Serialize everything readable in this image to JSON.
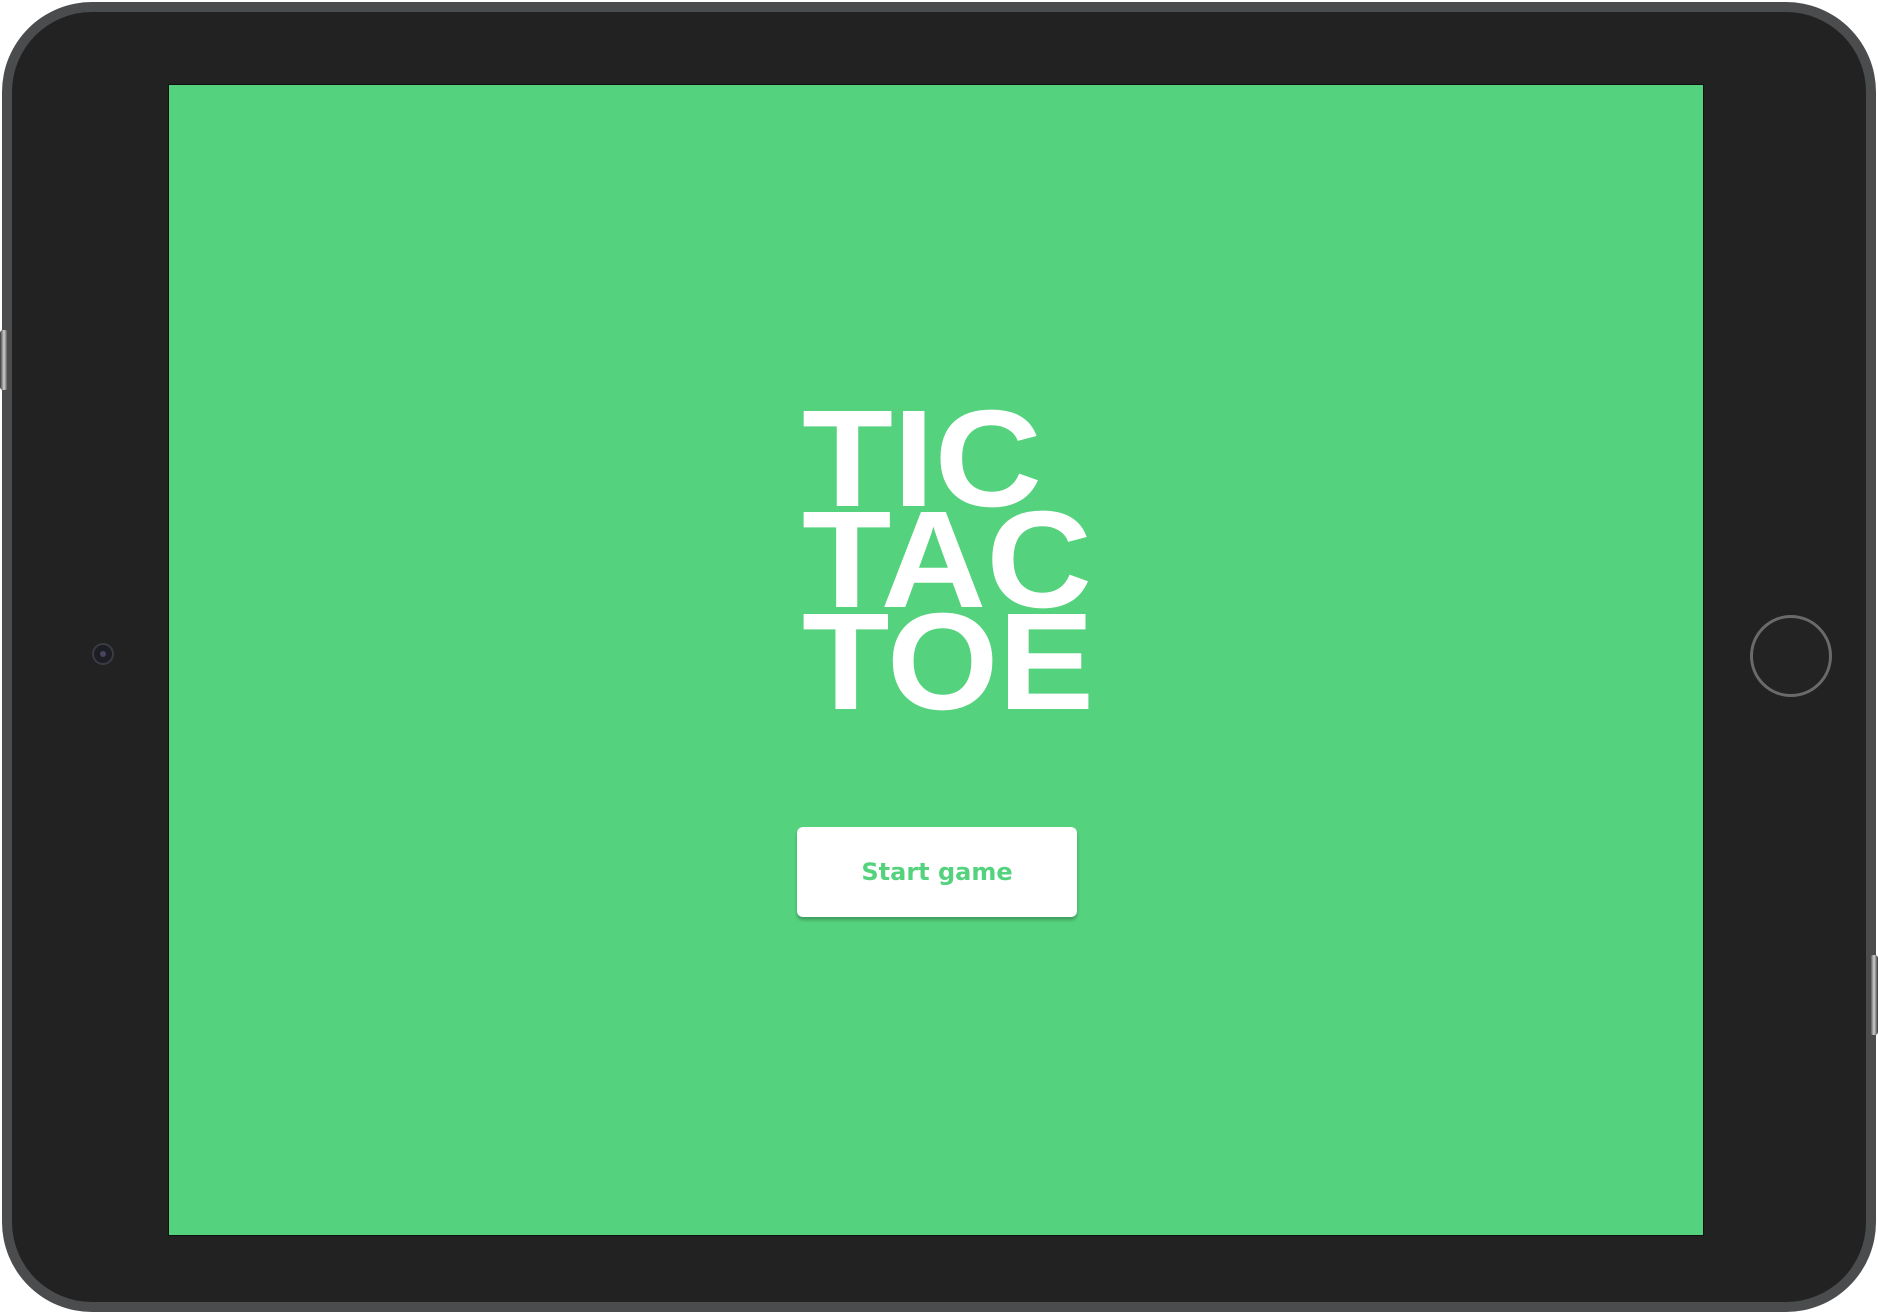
{
  "device": {
    "frame_color": "#222222",
    "bezel_color": "#4a4c4e",
    "camera_icon": "front-camera",
    "home_button_icon": "home-button-ring"
  },
  "screen": {
    "background_color": "#55d27d"
  },
  "logo": {
    "lines": [
      "TIC",
      "TAC",
      "TOE"
    ],
    "color": "#ffffff"
  },
  "start_button": {
    "label": "Start game",
    "text_color": "#55d27d",
    "background_color": "#ffffff"
  }
}
